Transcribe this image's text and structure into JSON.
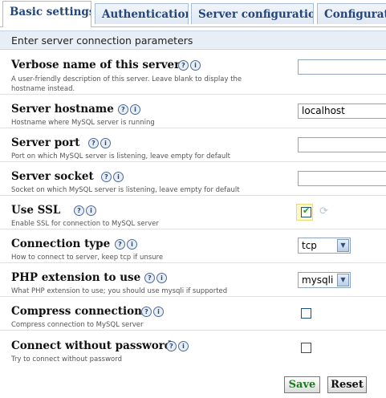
{
  "tabs": [
    {
      "label": "Basic settings",
      "active": true
    },
    {
      "label": "Authentication"
    },
    {
      "label": "Server configuration"
    },
    {
      "label": "Configurati"
    }
  ],
  "intro": "Enter server connection parameters",
  "rows": [
    {
      "title": "Verbose name of this server",
      "desc": "A user-friendly description of this server. Leave blank to display the hostname instead.",
      "value": ""
    },
    {
      "title": "Server hostname",
      "desc": "Hostname where MySQL server is running",
      "value": "localhost"
    },
    {
      "title": "Server port",
      "desc": "Port on which MySQL server is listening, leave empty for default",
      "value": ""
    },
    {
      "title": "Server socket",
      "desc": "Socket on which MySQL server is listening, leave empty for default",
      "value": ""
    },
    {
      "title": "Use SSL",
      "desc": "Enable SSL for connection to MySQL server",
      "checked": true
    },
    {
      "title": "Connection type",
      "desc": "How to connect to server, keep tcp if unsure",
      "selected": "tcp"
    },
    {
      "title": "PHP extension to use",
      "desc": "What PHP extension to use; you should use mysqli if supported",
      "selected": "mysqli"
    },
    {
      "title": "Compress connection",
      "desc": "Compress connection to MySQL server",
      "checked": false
    },
    {
      "title": "Connect without password",
      "desc": "Try to connect without password",
      "checked": false
    }
  ],
  "buttons": {
    "save": "Save",
    "reset": "Reset"
  },
  "icons": {
    "help": "help-icon",
    "info": "info-icon",
    "restore": "restore-default-icon"
  }
}
